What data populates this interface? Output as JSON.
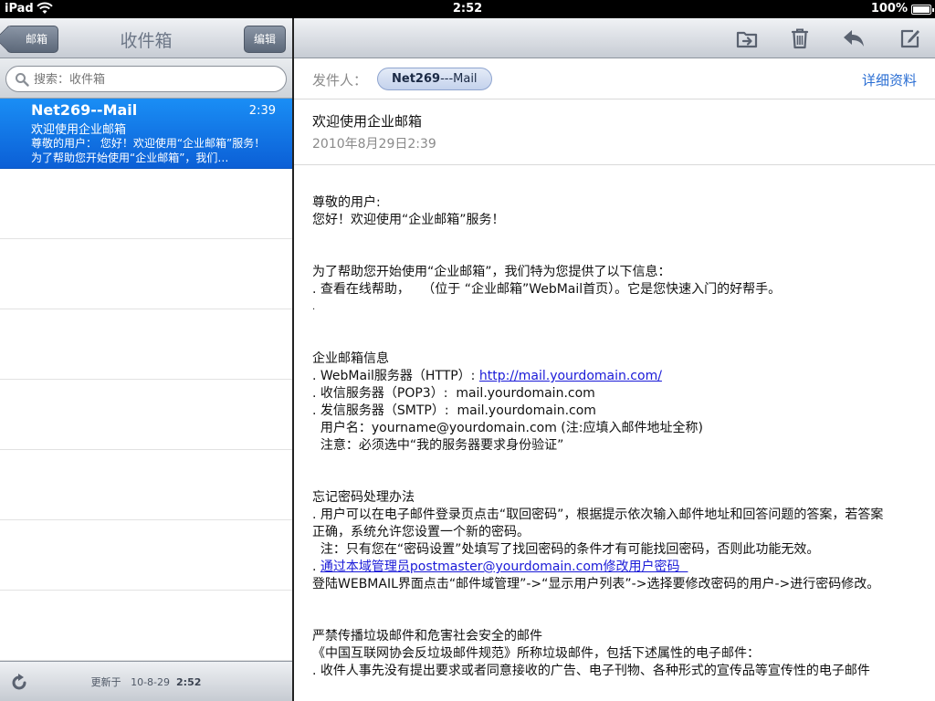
{
  "status": {
    "device": "iPad",
    "time": "2:52",
    "battery": "100%"
  },
  "left": {
    "back_label": "邮箱",
    "title": "收件箱",
    "edit_label": "编辑",
    "search_placeholder": "搜索：收件箱",
    "messages": [
      {
        "sender": "Net269--Mail",
        "time": "2:39",
        "subject": "欢迎使用企业邮箱",
        "preview": "尊敬的用户：  您好！欢迎使用“企业邮箱”服务！  为了帮助您开始使用“企业邮箱”，我们…"
      }
    ],
    "updated_label": "更新于",
    "updated_date": "10-8-29",
    "updated_time": "2:52"
  },
  "right": {
    "from_label": "发件人：",
    "from_name_bold": "Net269",
    "from_name_rest": "---Mail",
    "details_label": "详细资料",
    "subject": "欢迎使用企业邮箱",
    "date": "2010年8月29日2:39",
    "body": {
      "greeting1": "尊敬的用户:",
      "greeting2": "您好！欢迎使用“企业邮箱”服务！",
      "intro": "为了帮助您开始使用“企业邮箱”，我们特为您提供了以下信息：",
      "help": ". 查看在线帮助，   （位于 “企业邮箱”WebMail首页）。它是您快速入门的好帮手。",
      "dot": ".",
      "info_title": "企业邮箱信息",
      "webmail_prefix": ". WebMail服务器（HTTP）: ",
      "webmail_link": "http://mail.yourdomain.com/",
      "pop3": ". 收信服务器（POP3）:  mail.yourdomain.com",
      "smtp": ". 发信服务器（SMTP）:  mail.yourdomain.com",
      "username": "  用户名：yourname@yourdomain.com (注:应填入邮件地址全称)",
      "note_auth": "  注意：必须选中“我的服务器要求身份验证”",
      "pw_title": "忘记密码处理办法",
      "pw_1": ". 用户可以在电子邮件登录页点击“取回密码”，根据提示依次输入邮件地址和回答问题的答案，若答案正确，系统允许您设置一个新的密码。",
      "pw_note": "  注：只有您在“密码设置”处填写了找回密码的条件才有可能找回密码，否则此功能无效。",
      "pw_2_prefix": ". ",
      "pw_2_link": "通过本域管理员postmaster@yourdomain.com修改用户密码  ",
      "pw_3": "  登陆WEBMAIL界面点击“邮件域管理”->“显示用户列表”->选择要修改密码的用户->进行密码修改。",
      "spam_title": "严禁传播垃圾邮件和危害社会安全的邮件",
      "spam_1": "《中国互联网协会反垃圾邮件规范》所称垃圾邮件，包括下述属性的电子邮件：",
      "spam_2": ". 收件人事先没有提出要求或者同意接收的广告、电子刊物、各种形式的宣传品等宣传性的电子邮件"
    }
  }
}
